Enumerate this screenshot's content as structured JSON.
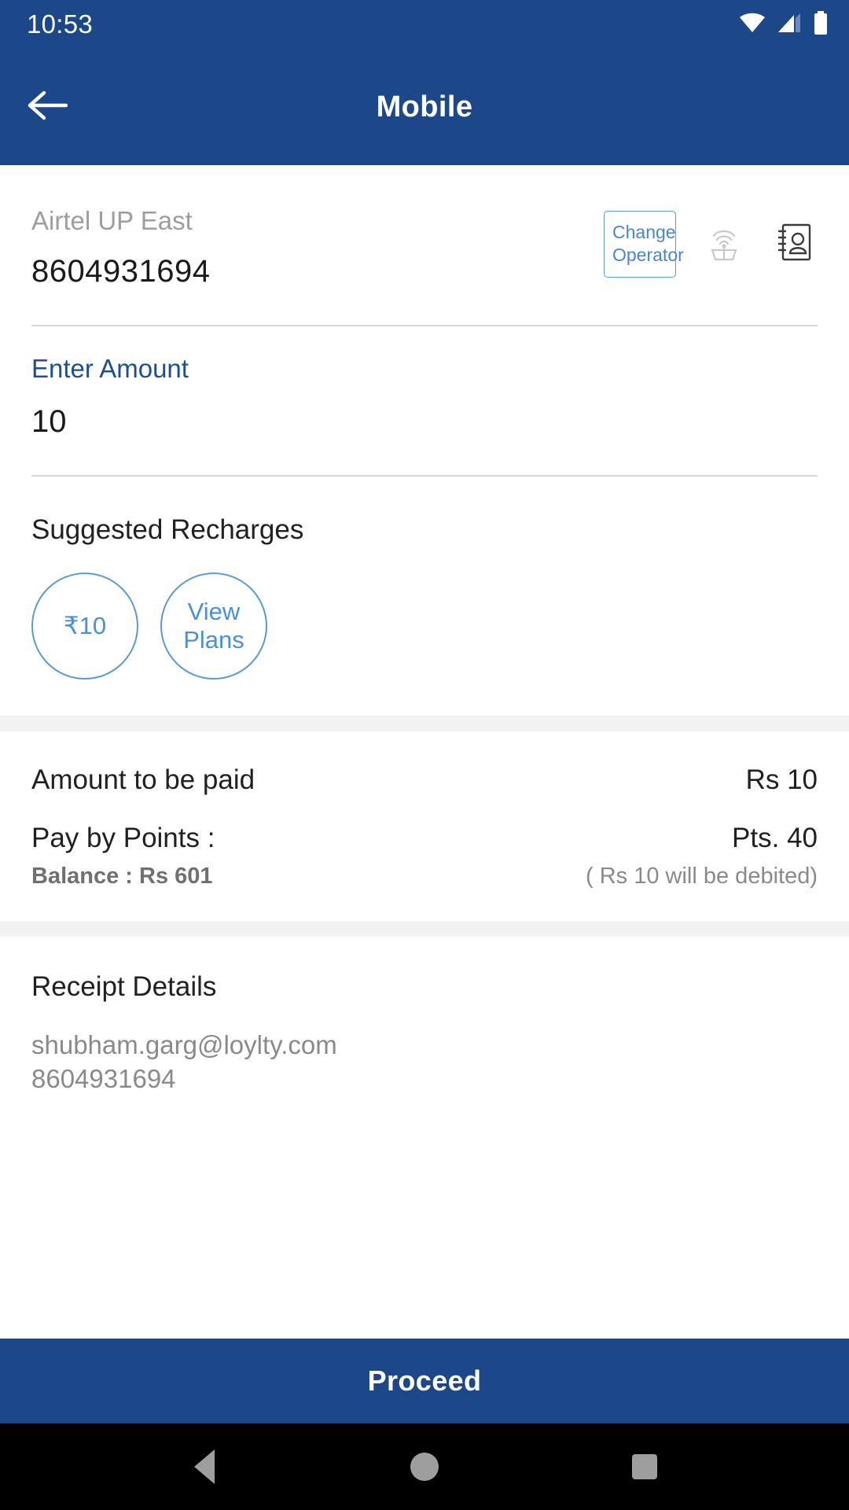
{
  "status_bar": {
    "time": "10:53",
    "icons": [
      "wifi-icon",
      "cellular-signal-icon",
      "battery-icon"
    ]
  },
  "app_bar": {
    "title": "Mobile",
    "back_icon": "arrow-left-icon"
  },
  "colors": {
    "header_blue": "#1C4789",
    "accent_blue": "#4A90D9",
    "label_blue": "#1C5095",
    "muted_gray": "#8A8A8A",
    "divider": "#D8D8D8",
    "band": "#F2F2F2"
  },
  "operator": {
    "name": "Airtel UP East",
    "number": "8604931694",
    "change_operator_label": "Change\nOperator",
    "change_operator_line1": "Change",
    "change_operator_line2": "Operator",
    "tower_icon": "signal-tower-icon",
    "contacts_icon": "contact-book-icon"
  },
  "amount_field": {
    "label": "Enter Amount",
    "value": "10",
    "placeholder": "Enter Amount"
  },
  "suggested": {
    "title": "Suggested Recharges",
    "chips": [
      {
        "label": "₹10",
        "name": "suggested-amount-10"
      },
      {
        "label": "View Plans",
        "line1": "View",
        "line2": "Plans",
        "name": "view-plans"
      }
    ]
  },
  "payment": {
    "amount_label": "Amount to be paid",
    "amount_value": "Rs 10",
    "points_label": "Pay by Points :",
    "points_value": "Pts. 40",
    "balance_text": "Balance : Rs 601",
    "debit_note": "( Rs 10 will be debited)"
  },
  "receipt": {
    "title": "Receipt Details",
    "email": "shubham.garg@loylty.com",
    "phone": "8604931694"
  },
  "proceed": {
    "label": "Proceed"
  },
  "nav_bar": {
    "back": "nav-back-icon",
    "home": "nav-home-icon",
    "recents": "nav-recents-icon"
  }
}
